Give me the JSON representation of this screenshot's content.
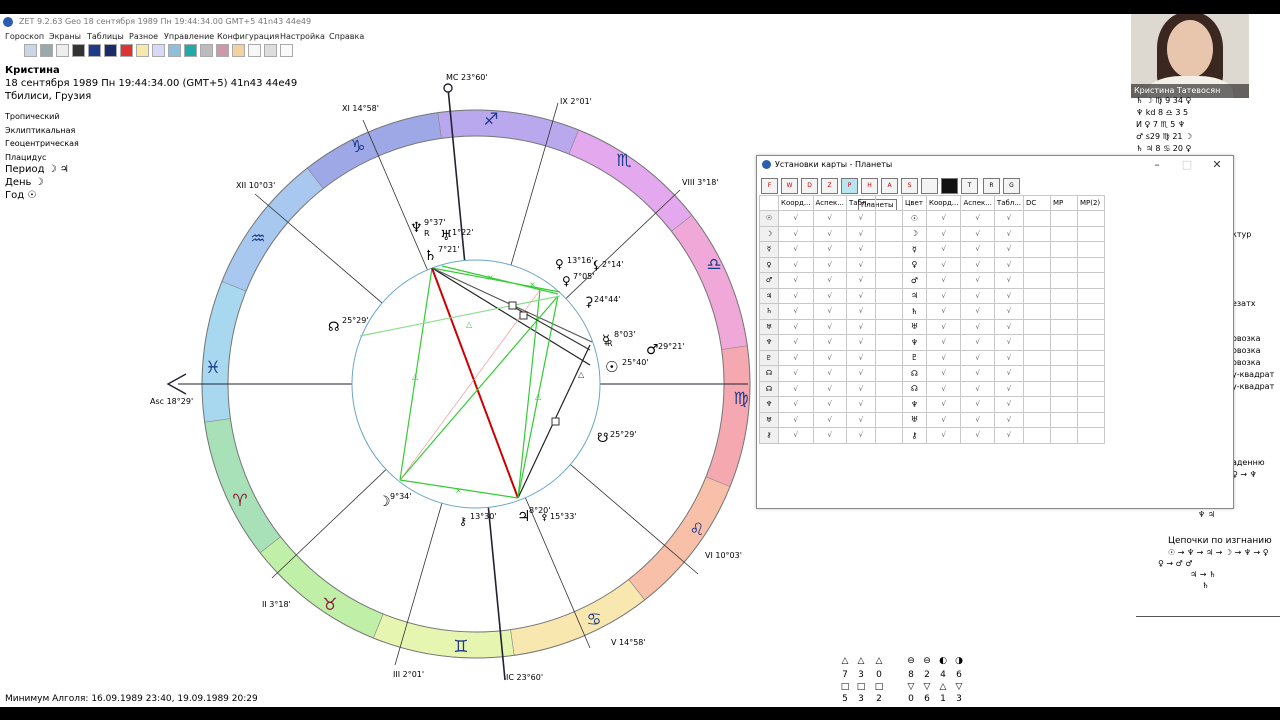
{
  "window": {
    "title": "ZET 9.2.63 Geo   18 сентября 1989  Пн  19:44:34.00 GMT+5 41n43  44e49"
  },
  "menu": [
    "Гороскоп",
    "Экраны",
    "Таблицы",
    "Разное",
    "Управление",
    "Конфигурация",
    "Настройка",
    "Справка"
  ],
  "chart_info": {
    "name": "Кристина",
    "datetime": "18 сентября 1989  Пн  19:44:34.00 (GMT+5) 41n43  44e49",
    "place": "Тбилиси, Грузия",
    "settings": [
      "Тропический",
      "Эклиптикальная",
      "Геоцентрическая",
      "Плацидус"
    ],
    "period": [
      {
        "label": "Период",
        "value": "☽ ♃"
      },
      {
        "label": "День",
        "value": "☽"
      },
      {
        "label": "Год",
        "value": "☉"
      }
    ]
  },
  "wheel": {
    "angles": {
      "mc": "MC 23°60'",
      "ic": "IC 23°60'",
      "asc": "Asc 18°29'"
    },
    "cusps": {
      "xi": "XI 14°58'",
      "x_xii": "XII 10°03'",
      "ix": "IX 2°01'",
      "viii": "VIII 3°18'",
      "vi": "VI 10°03'",
      "v": "V 14°58'",
      "iii": "III 2°01'",
      "ii": "II 3°18'"
    },
    "signs": [
      "♐",
      "♑",
      "♒",
      "♓",
      "♈",
      "♉",
      "♊",
      "♋",
      "♌",
      "♍",
      "♎",
      "♏"
    ],
    "planets": [
      {
        "glyph": "♆",
        "deg": "9°37'",
        "retro": "R"
      },
      {
        "glyph": "♅",
        "deg": "1°22'",
        "retro": ""
      },
      {
        "glyph": "♄",
        "deg": "7°21'",
        "retro": ""
      },
      {
        "glyph": "♀",
        "deg": "13°16'",
        "retro": ""
      },
      {
        "glyph": "⚸",
        "deg": "2°14'",
        "retro": ""
      },
      {
        "glyph": "♀",
        "deg": "7°05'",
        "retro": ""
      },
      {
        "glyph": "⚳",
        "deg": "24°44'",
        "retro": ""
      },
      {
        "glyph": "☿",
        "deg": "8°03'",
        "retro": "R"
      },
      {
        "glyph": "♂",
        "deg": "29°21'",
        "retro": ""
      },
      {
        "glyph": "☉",
        "deg": "25°40'",
        "retro": ""
      },
      {
        "glyph": "☋",
        "deg": "25°29'",
        "retro": ""
      },
      {
        "glyph": "☊",
        "deg": "25°29'",
        "retro": ""
      },
      {
        "glyph": "☽",
        "deg": "9°34'",
        "retro": ""
      },
      {
        "glyph": "♃",
        "deg": "8°20'",
        "retro": ""
      },
      {
        "glyph": "⚷",
        "deg": "13°30'",
        "retro": ""
      },
      {
        "glyph": "⚴",
        "deg": "15°33'",
        "retro": ""
      }
    ]
  },
  "dialog": {
    "title": "Установки карты - Планеты",
    "tool_labels": [
      "F",
      "W",
      "D",
      "Z",
      "P",
      "H",
      "A",
      "S",
      "",
      "",
      "T",
      "R",
      "G"
    ],
    "tooltip": "Планеты",
    "headers": [
      "Коорд...",
      "Аспек...",
      "Табл...",
      "",
      "Цвет",
      "Коорд...",
      "Аспек...",
      "Табл...",
      "DC",
      "MP",
      "MP(2)"
    ],
    "rows": [
      "☉",
      "☽",
      "☿",
      "♀",
      "♂",
      "♃",
      "♄",
      "♅",
      "♆",
      "♇",
      "☊",
      "⚷",
      "⚳",
      "⚸",
      "⚴",
      "⚵",
      "♆"
    ],
    "row_glyphs": [
      "☉",
      "☽",
      "☿",
      "♀",
      "♂",
      "♃",
      "♄",
      "♅",
      "♆",
      "♇",
      "☊",
      "☊",
      "♆",
      "♅",
      "⚷"
    ],
    "check": "√"
  },
  "webcam": {
    "caption": "Кристина Татевосян"
  },
  "right_panel": {
    "lines": [
      "♄ ☽ ♍ 9  34  ♀",
      "♆ kd 8 ♎ 3  5",
      "И  ♀   7 ♏ 5  ♆",
      "   ♂ s29 ♍ 21 ☽",
      "♄ ♃ 8 ♋ 20  ♀",
      "ктур",
      "езатх",
      "овозка",
      "овозка",
      "овозка",
      "у-квадрат",
      "у-квадрат",
      "аденню",
      "♀ → ♆",
      "♆ ♃",
      "Цепочки по изгнанию",
      "☉ → ♆ → ♃ → ☽ → ♆ → ♀",
      "♀ → ♂ ♂",
      "♃ → ♄",
      "♄"
    ]
  },
  "footer": {
    "text": "Минимум Алголя: 16.09.1989 23:40,  19.09.1989 20:29"
  },
  "stats": {
    "row1_glyphs": [
      "△",
      "△",
      "△",
      "⊖",
      "⊖",
      "◐",
      "◑"
    ],
    "row1_vals": [
      "7",
      "3",
      "0",
      "8",
      "2",
      "4",
      "6"
    ],
    "row2_glyphs": [
      "□",
      "□",
      "□",
      "▽",
      "▽",
      "△",
      "▽"
    ],
    "row2_vals": [
      "5",
      "3",
      "2",
      "0",
      "6",
      "1",
      "3"
    ]
  },
  "colors": {
    "green_aspect": "#33cc33",
    "red_aspect": "#cc0000",
    "dark_aspect": "#222222"
  }
}
